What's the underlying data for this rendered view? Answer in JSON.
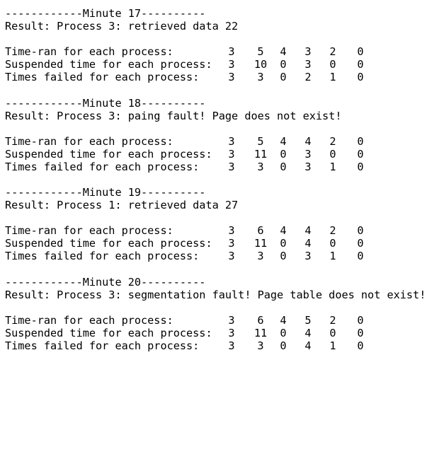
{
  "blocks": [
    {
      "header": "------------Minute 17----------",
      "result": "Result: Process 3: retrieved data 22",
      "rows": [
        {
          "label": "Time-ran for each process:",
          "values": [
            "3",
            "5",
            "4",
            "3",
            "2",
            "0"
          ]
        },
        {
          "label": "Suspended time for each process:",
          "values": [
            "3",
            "10",
            "0",
            "3",
            "0",
            "0"
          ]
        },
        {
          "label": "Times failed for each process:",
          "values": [
            "3",
            "3",
            "0",
            "2",
            "1",
            "0"
          ]
        }
      ]
    },
    {
      "header": "------------Minute 18----------",
      "result": "Result: Process 3: paing fault! Page does not exist!",
      "rows": [
        {
          "label": "Time-ran for each process:",
          "values": [
            "3",
            "5",
            "4",
            "4",
            "2",
            "0"
          ]
        },
        {
          "label": "Suspended time for each process:",
          "values": [
            "3",
            "11",
            "0",
            "3",
            "0",
            "0"
          ]
        },
        {
          "label": "Times failed for each process:",
          "values": [
            "3",
            "3",
            "0",
            "3",
            "1",
            "0"
          ]
        }
      ]
    },
    {
      "header": "------------Minute 19----------",
      "result": "Result: Process 1: retrieved data 27",
      "rows": [
        {
          "label": "Time-ran for each process:",
          "values": [
            "3",
            "6",
            "4",
            "4",
            "2",
            "0"
          ]
        },
        {
          "label": "Suspended time for each process:",
          "values": [
            "3",
            "11",
            "0",
            "4",
            "0",
            "0"
          ]
        },
        {
          "label": "Times failed for each process:",
          "values": [
            "3",
            "3",
            "0",
            "3",
            "1",
            "0"
          ]
        }
      ]
    },
    {
      "header": "------------Minute 20----------",
      "result": "Result: Process 3: segmentation fault! Page table does not exist!",
      "rows": [
        {
          "label": "Time-ran for each process:",
          "values": [
            "3",
            "6",
            "4",
            "5",
            "2",
            "0"
          ]
        },
        {
          "label": "Suspended time for each process:",
          "values": [
            "3",
            "11",
            "0",
            "4",
            "0",
            "0"
          ]
        },
        {
          "label": "Times failed for each process:",
          "values": [
            "3",
            "3",
            "0",
            "4",
            "1",
            "0"
          ]
        }
      ]
    }
  ]
}
